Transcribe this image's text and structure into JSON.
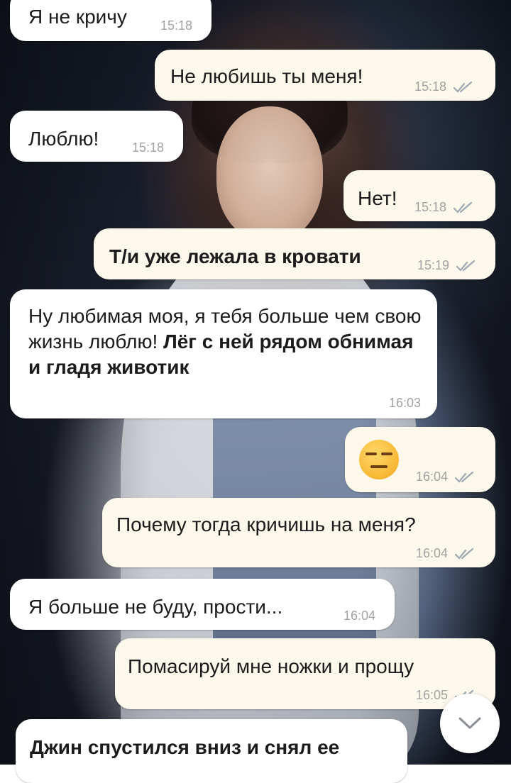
{
  "messages": [
    {
      "text": "Я не кричу",
      "time": "15:18"
    },
    {
      "text": "Не любишь ты меня!",
      "time": "15:18"
    },
    {
      "text": "Люблю!",
      "time": "15:18"
    },
    {
      "text": "Нет!",
      "time": "15:18"
    },
    {
      "text": "Т/и уже лежала в кровати",
      "time": "15:19"
    },
    {
      "text": "Ну любимая моя, я тебя больше чем свою жизнь люблю!",
      "text_bold": "Лёг с ней рядом обнимая и гладя животик",
      "time": "16:03"
    },
    {
      "emoji": "expressionless-face-emoji",
      "time": "16:04"
    },
    {
      "text": "Почему тогда кричишь на меня?",
      "time": "16:04"
    },
    {
      "text": "Я больше не буду, прости...",
      "time": "16:04"
    },
    {
      "text": "Помасируй мне ножки и прощу",
      "time": "16:05"
    },
    {
      "text": "Джин спустился вниз и снял ее"
    }
  ],
  "colors": {
    "incoming_bubble": "#ffffff",
    "outgoing_bubble": "#fdf8ec",
    "timestamp": "#a2a2a2",
    "read_check": "#9fa9b3"
  },
  "icons": {
    "read_receipt": "double-check-icon",
    "scroll_down": "chevron-down-icon"
  }
}
